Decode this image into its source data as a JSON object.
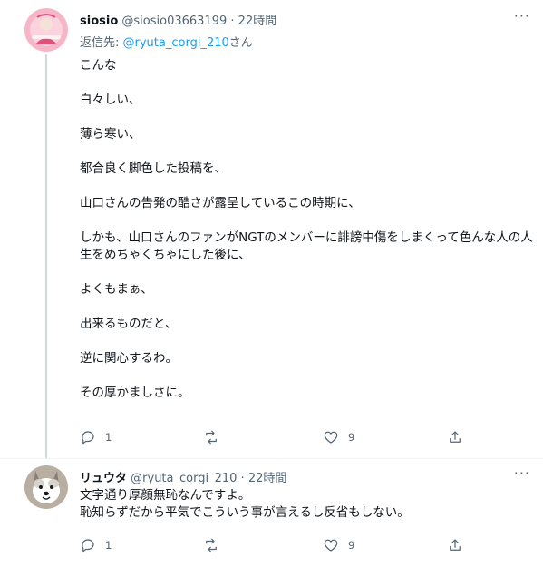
{
  "tweets": [
    {
      "display_name": "siosio",
      "handle": "@siosio03663199",
      "separator": "·",
      "time": "22時間",
      "reply_prefix": "返信先: ",
      "reply_mention": "@ryuta_corgi_210",
      "reply_suffix": "さん",
      "paragraphs": [
        "こんな",
        "白々しい、",
        "薄ら寒い、",
        "都合良く脚色した投稿を、",
        "山口さんの告発の酷さが露呈しているこの時期に、",
        "しかも、山口さんのファンがNGTのメンバーに誹謗中傷をしまくって色んな人の人生をめちゃくちゃにした後に、",
        "よくもまぁ、",
        "出来るものだと、",
        "逆に関心するわ。",
        "その厚かましさに。"
      ],
      "reply_count": "1",
      "retweet_count": "",
      "like_count": "9",
      "more": "···",
      "avatar_colors": {
        "bg": "#f7b6c8",
        "accent": "#e0507a"
      }
    },
    {
      "display_name": "リュウタ",
      "handle": "@ryuta_corgi_210",
      "separator": "·",
      "time": "22時間",
      "lines": [
        "文字通り厚顔無恥なんですよ。",
        "恥知らずだから平気でこういう事が言えるし反省もしない。"
      ],
      "reply_count": "1",
      "retweet_count": "",
      "like_count": "9",
      "more": "···",
      "avatar_colors": {
        "bg": "#b9aea2",
        "dog": "#ffffff"
      }
    }
  ],
  "colors": {
    "text": "#0f1419",
    "secondary": "#536471",
    "link": "#1d9bf0",
    "thread_line": "#cfd9de"
  }
}
